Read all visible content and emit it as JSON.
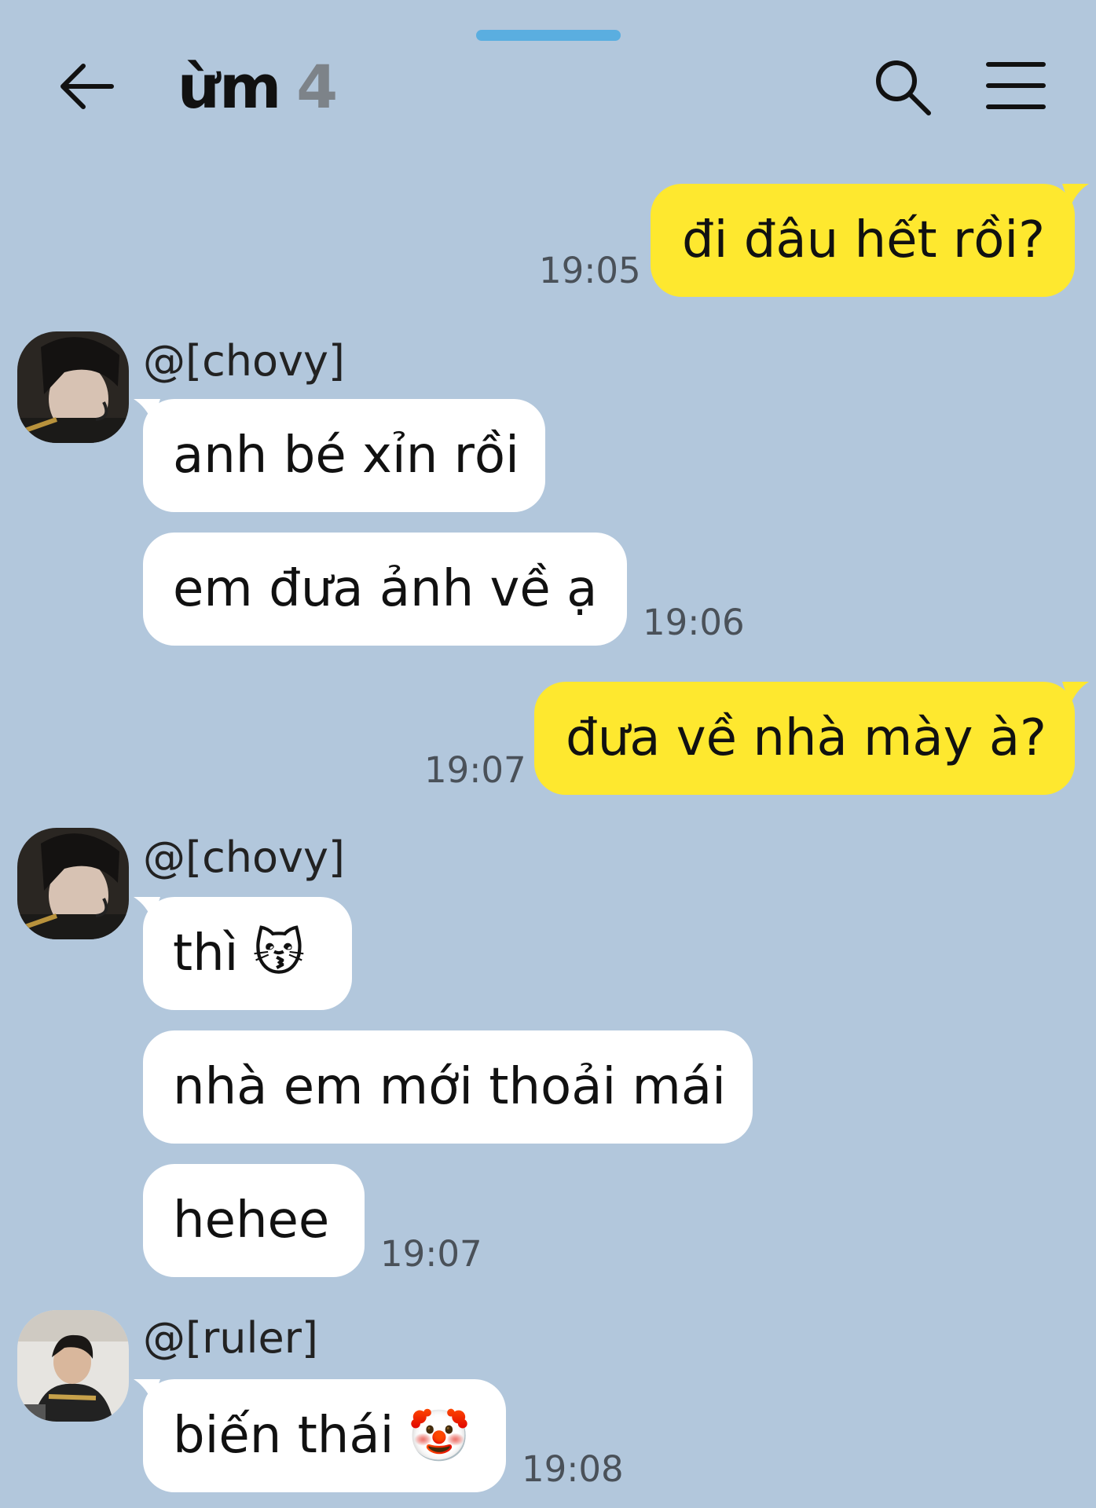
{
  "header": {
    "title": "ừm",
    "member_count": "4",
    "back_icon": "arrow-left-icon",
    "search_icon": "search-icon",
    "menu_icon": "hamburger-menu-icon"
  },
  "messages": [
    {
      "sender": "me",
      "text": "đi đâu hết rồi?",
      "time": "19:05"
    },
    {
      "sender": "@[chovy]",
      "text": "anh bé xỉn rồi"
    },
    {
      "sender": "@[chovy]",
      "text": "em đưa ảnh về ạ",
      "time": "19:06"
    },
    {
      "sender": "me",
      "text": "đưa về nhà mày à?",
      "time": "19:07"
    },
    {
      "sender": "@[chovy]",
      "text": "thì",
      "emoji": "😽"
    },
    {
      "sender": "@[chovy]",
      "text": "nhà em mới thoải mái"
    },
    {
      "sender": "@[chovy]",
      "text": "hehee",
      "time": "19:07"
    },
    {
      "sender": "@[ruler]",
      "text": "biến thái",
      "emoji": "🤡",
      "time": "19:08"
    }
  ],
  "senders": {
    "chovy_1": "@[chovy]",
    "chovy_2": "@[chovy]",
    "ruler": "@[ruler]"
  },
  "colors": {
    "background": "#b2c7dc",
    "my_bubble": "#fee82f",
    "their_bubble": "#ffffff",
    "handle": "#5aaee0"
  }
}
